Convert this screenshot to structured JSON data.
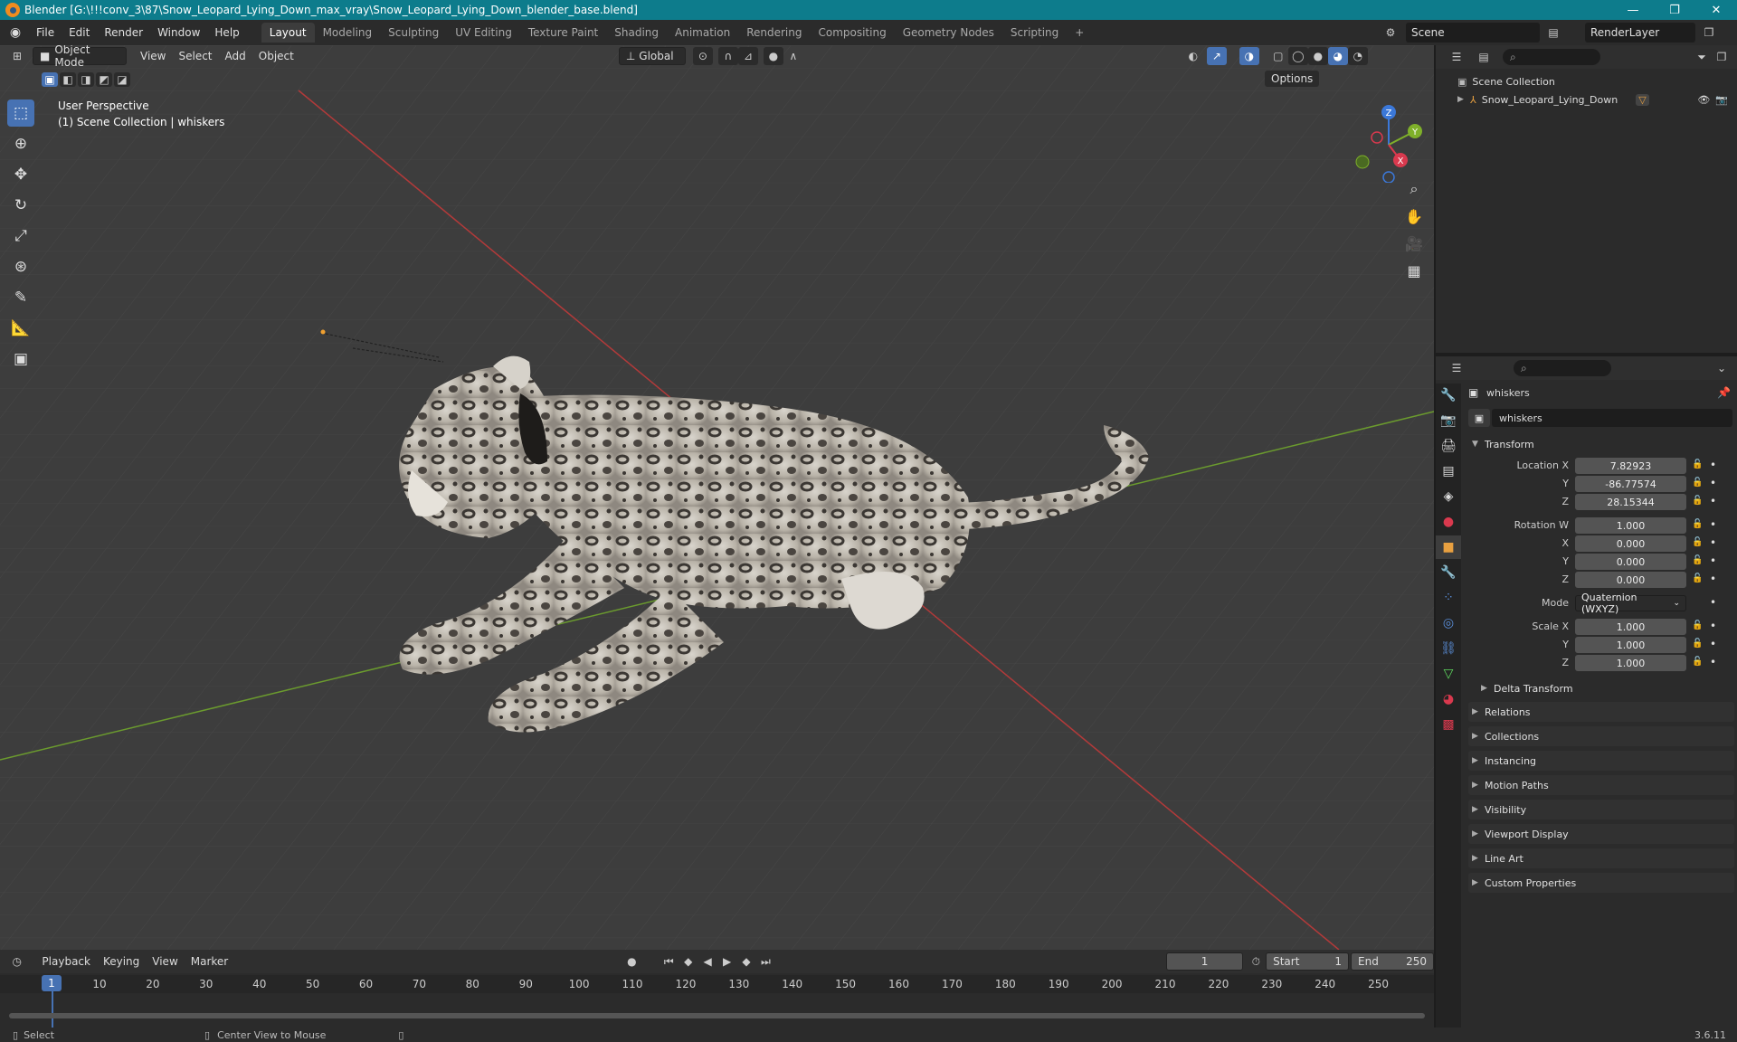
{
  "window": {
    "title": "Blender [G:\\!!!conv_3\\87\\Snow_Leopard_Lying_Down_max_vray\\Snow_Leopard_Lying_Down_blender_base.blend]",
    "minimize": "—",
    "maximize": "❐",
    "close": "✕"
  },
  "menubar": {
    "menus": [
      "File",
      "Edit",
      "Render",
      "Window",
      "Help"
    ],
    "workspaces": [
      "Layout",
      "Modeling",
      "Sculpting",
      "UV Editing",
      "Texture Paint",
      "Shading",
      "Animation",
      "Rendering",
      "Compositing",
      "Geometry Nodes",
      "Scripting"
    ],
    "add_tab": "+",
    "scene": "Scene",
    "view_layer": "RenderLayer"
  },
  "viewport": {
    "mode": "Object Mode",
    "menus": [
      "View",
      "Select",
      "Add",
      "Object"
    ],
    "orientation": "Global",
    "options": "Options",
    "perspective": "User Perspective",
    "collection_info": "(1) Scene Collection | whiskers",
    "gizmo_labels": {
      "x": "X",
      "y": "Y",
      "z": "Z"
    }
  },
  "outliner": {
    "root": "Scene Collection",
    "object": "Snow_Leopard_Lying_Down"
  },
  "properties": {
    "object_name": "whiskers",
    "datablock": "whiskers",
    "transform_header": "Transform",
    "location_label": "Location X",
    "y_label": "Y",
    "z_label": "Z",
    "x_label": "X",
    "location": {
      "x": "7.82923",
      "y": "-86.77574",
      "z": "28.15344"
    },
    "rotation_label": "Rotation W",
    "rotation": {
      "w": "1.000",
      "x": "0.000",
      "y": "0.000",
      "z": "0.000"
    },
    "mode_label": "Mode",
    "mode_value": "Quaternion (WXYZ)",
    "scale_label": "Scale X",
    "scale": {
      "x": "1.000",
      "y": "1.000",
      "z": "1.000"
    },
    "delta": "Delta Transform",
    "sections": [
      "Relations",
      "Collections",
      "Instancing",
      "Motion Paths",
      "Visibility",
      "Viewport Display",
      "Line Art",
      "Custom Properties"
    ]
  },
  "timeline": {
    "menus": [
      "Playback",
      "Keying",
      "View",
      "Marker"
    ],
    "current_frame": "1",
    "start_label": "Start",
    "start": "1",
    "end_label": "End",
    "end": "250",
    "ticks": [
      "1",
      "10",
      "20",
      "30",
      "40",
      "50",
      "60",
      "70",
      "80",
      "90",
      "100",
      "110",
      "120",
      "130",
      "140",
      "150",
      "160",
      "170",
      "180",
      "190",
      "200",
      "210",
      "220",
      "230",
      "240",
      "250"
    ]
  },
  "statusbar": {
    "select": "Select",
    "center_view": "Center View to Mouse",
    "version": "3.6.11"
  },
  "colors": {
    "title_bar": "#0d7c8c",
    "accent": "#4772b3",
    "axis_x": "#c23b3b",
    "axis_y": "#6a9e2a"
  }
}
